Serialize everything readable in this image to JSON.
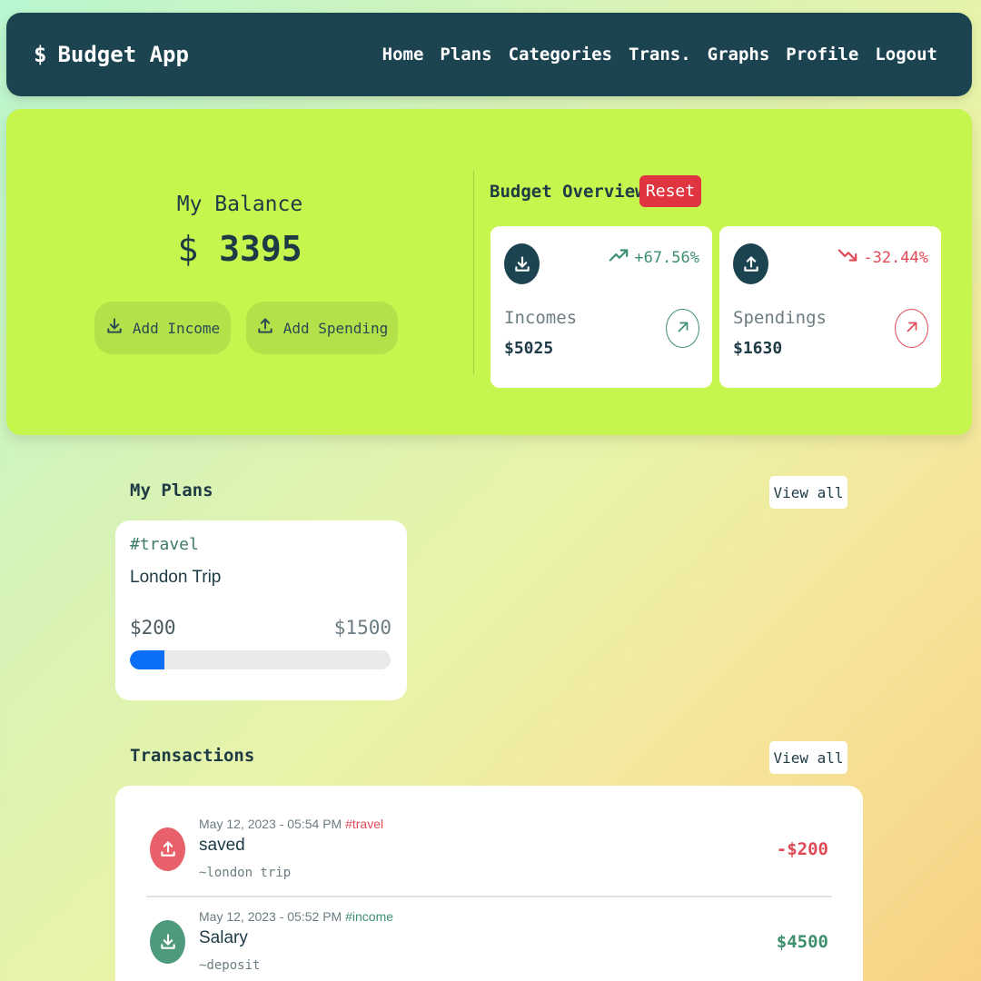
{
  "navbar": {
    "brand_symbol": "$",
    "brand_name": "Budget App",
    "links": [
      "Home",
      "Plans",
      "Categories",
      "Trans.",
      "Graphs",
      "Profile",
      "Logout"
    ]
  },
  "balance": {
    "label": "My Balance",
    "currency": "$",
    "amount": "3395",
    "add_income_label": "Add Income",
    "add_spending_label": "Add Spending"
  },
  "overview": {
    "title": "Budget Overview",
    "reset_label": "Reset",
    "incomes": {
      "trend": "+67.56%",
      "label": "Incomes",
      "amount": "$5025"
    },
    "spendings": {
      "trend": "-32.44%",
      "label": "Spendings",
      "amount": "$1630"
    }
  },
  "plans": {
    "title": "My Plans",
    "view_all_label": "View all",
    "items": [
      {
        "tag": "#travel",
        "name": "London Trip",
        "saved": "$200",
        "target": "$1500",
        "progress": 0.133
      }
    ]
  },
  "transactions": {
    "title": "Transactions",
    "view_all_label": "View all",
    "items": [
      {
        "date": "May 12, 2023 - 05:54 PM",
        "tag": "#travel",
        "title": "saved",
        "note": "~london trip",
        "amount": "-$200"
      },
      {
        "date": "May 12, 2023 - 05:52 PM",
        "tag": "#income",
        "title": "Salary",
        "note": "~deposit",
        "amount": "$4500"
      }
    ]
  },
  "colors": {
    "navbar_bg": "#1b4350",
    "hero_bg": "#c6f64e",
    "reset_red": "#e03541",
    "income_green": "#3d8f6e",
    "spending_red": "#e04a55",
    "progress_blue": "#0b6ef6"
  },
  "icons": {
    "income": "download-tray-icon",
    "spending": "upload-tray-icon",
    "trend_up": "trending-up-icon",
    "trend_down": "trending-down-icon",
    "arrow": "arrow-up-right-icon"
  }
}
